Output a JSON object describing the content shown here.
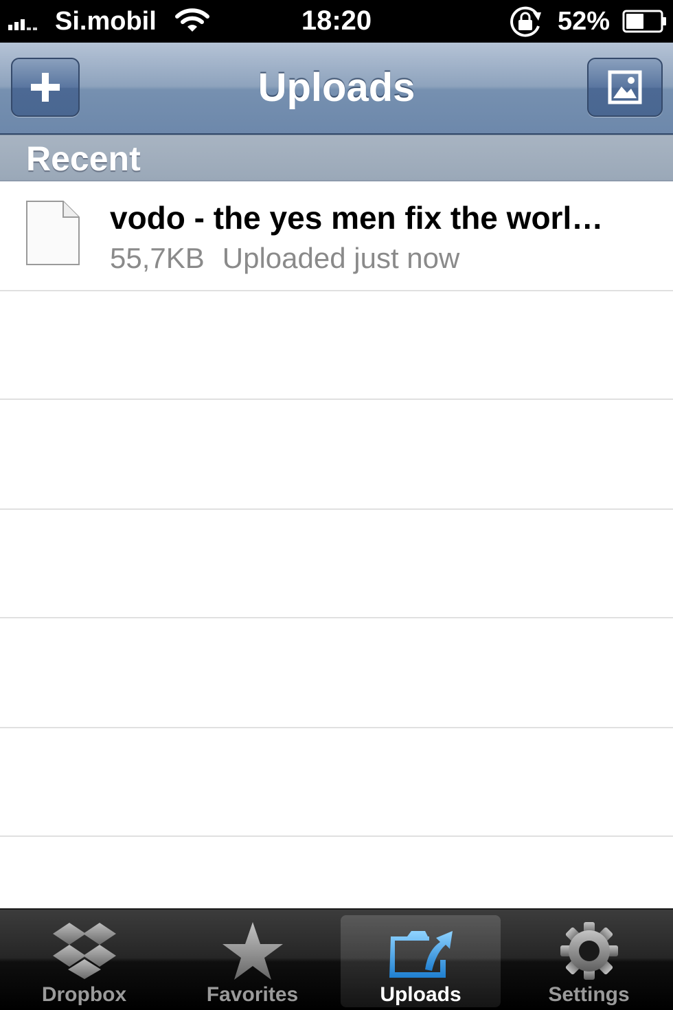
{
  "status_bar": {
    "carrier": "Si.mobil",
    "time": "18:20",
    "battery_percent": "52%",
    "battery_level": 0.52,
    "signal_bars": 3,
    "icons": [
      "signal-icon",
      "wifi-icon",
      "rotation-lock-icon",
      "battery-icon"
    ]
  },
  "nav": {
    "title": "Uploads",
    "left_button_icon": "plus-icon",
    "right_button_icon": "photo-icon"
  },
  "section": {
    "header": "Recent"
  },
  "uploads": [
    {
      "title": "vodo - the yes men fix the worl…",
      "size": "55,7KB",
      "status": "Uploaded just now",
      "icon": "file-icon"
    }
  ],
  "tabs": [
    {
      "label": "Dropbox",
      "icon": "dropbox-icon",
      "selected": false
    },
    {
      "label": "Favorites",
      "icon": "star-icon",
      "selected": false
    },
    {
      "label": "Uploads",
      "icon": "upload-folder-icon",
      "selected": true
    },
    {
      "label": "Settings",
      "icon": "gear-icon",
      "selected": false
    }
  ],
  "colors": {
    "nav_bar": "#7a93b2",
    "section_header": "#a0adbc",
    "tab_selected_blue": "#3fa7ec"
  }
}
